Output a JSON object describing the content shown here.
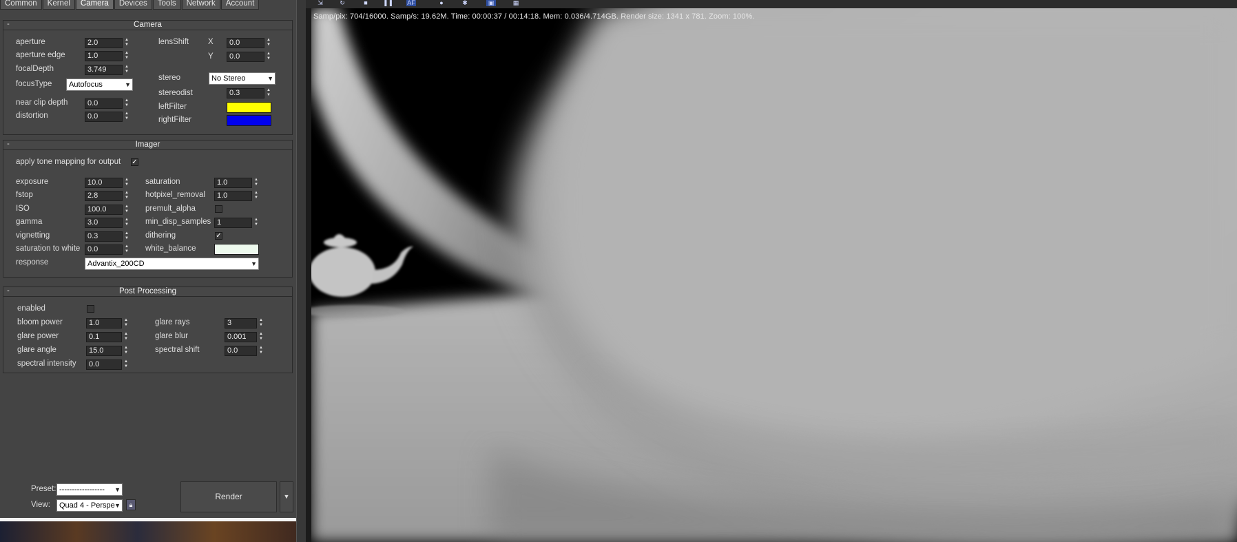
{
  "tabs": [
    "Common",
    "Kernel",
    "Camera",
    "Devices",
    "Tools",
    "Network",
    "Account"
  ],
  "active_tab": "Camera",
  "camera": {
    "title": "Camera",
    "collapse": "-",
    "aperture_label": "aperture",
    "aperture": "2.0",
    "aperture_edge_label": "aperture edge",
    "aperture_edge": "1.0",
    "focal_depth_label": "focalDepth",
    "focal_depth": "3.749",
    "focus_type_label": "focusType",
    "focus_type": "Autofocus",
    "near_clip_label": "near clip depth",
    "near_clip": "0.0",
    "distortion_label": "distortion",
    "distortion": "0.0",
    "lens_shift_label": "lensShift",
    "x_label": "X",
    "lens_shift_x": "0.0",
    "y_label": "Y",
    "lens_shift_y": "0.0",
    "stereo_label": "stereo",
    "stereo": "No Stereo",
    "stereodist_label": "stereodist",
    "stereodist": "0.3",
    "left_filter_label": "leftFilter",
    "left_filter_color": "#ffff00",
    "right_filter_label": "rightFilter",
    "right_filter_color": "#0000f0"
  },
  "imager": {
    "title": "Imager",
    "collapse": "-",
    "tone_mapping_label": "apply tone mapping for output",
    "tone_mapping": true,
    "exposure_label": "exposure",
    "exposure": "10.0",
    "fstop_label": "fstop",
    "fstop": "2.8",
    "iso_label": "ISO",
    "iso": "100.0",
    "gamma_label": "gamma",
    "gamma": "3.0",
    "vignetting_label": "vignetting",
    "vignetting": "0.3",
    "sat_white_label": "saturation to white",
    "sat_white": "0.0",
    "response_label": "response",
    "response": "Advantix_200CD",
    "saturation_label": "saturation",
    "saturation": "1.0",
    "hotpixel_label": "hotpixel_removal",
    "hotpixel": "1.0",
    "premult_label": "premult_alpha",
    "premult": false,
    "min_disp_label": "min_disp_samples",
    "min_disp": "1",
    "dithering_label": "dithering",
    "dithering": true,
    "white_balance_label": "white_balance",
    "white_balance_color": "#eefaee"
  },
  "post": {
    "title": "Post Processing",
    "collapse": "-",
    "enabled_label": "enabled",
    "enabled": false,
    "bloom_label": "bloom power",
    "bloom": "1.0",
    "glare_power_label": "glare power",
    "glare_power": "0.1",
    "glare_angle_label": "glare angle",
    "glare_angle": "15.0",
    "spectral_intensity_label": "spectral intensity",
    "spectral_intensity": "0.0",
    "glare_rays_label": "glare rays",
    "glare_rays": "3",
    "glare_blur_label": "glare blur",
    "glare_blur": "0.001",
    "spectral_shift_label": "spectral shift",
    "spectral_shift": "0.0"
  },
  "footer": {
    "preset_label": "Preset:",
    "preset": "------------------",
    "view_label": "View:",
    "view": "Quad 4 - Perspe",
    "render_label": "Render"
  },
  "viewport": {
    "status": "Samp/pix: 704/16000.   Samp/s: 19.62M.   Time: 00:00:37 / 00:14:18.   Mem: 0.036/4.714GB.   Render size: 1341 x 781.   Zoom: 100%."
  }
}
